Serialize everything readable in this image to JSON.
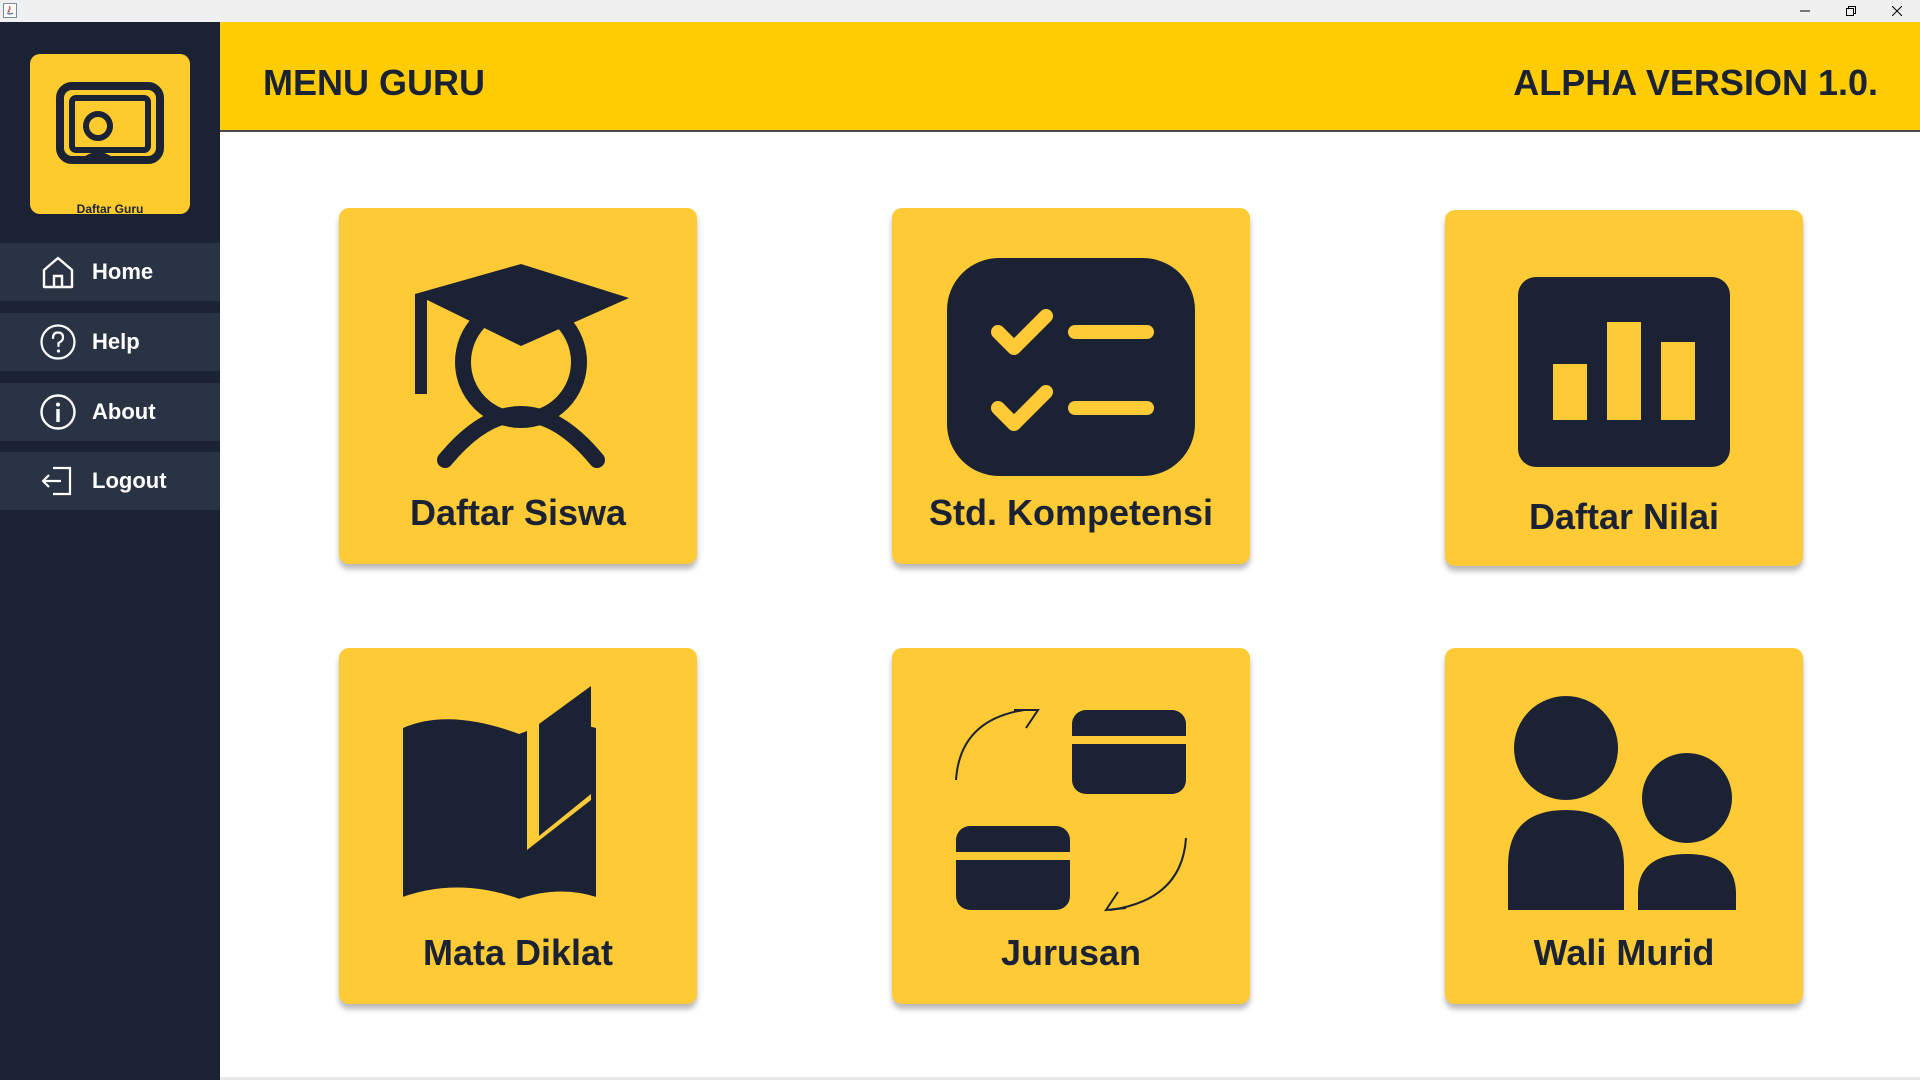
{
  "window": {
    "title_icon": "java-app-icon",
    "controls": [
      {
        "name": "minimize-icon",
        "glyph": "—"
      },
      {
        "name": "restore-icon",
        "glyph": "❐"
      },
      {
        "name": "close-icon",
        "glyph": "✕"
      }
    ]
  },
  "sidebar": {
    "logo_text": "Daftar Guru",
    "items": [
      {
        "label": "Home",
        "icon": "home-icon"
      },
      {
        "label": "Help",
        "icon": "help-icon"
      },
      {
        "label": "About",
        "icon": "info-icon"
      },
      {
        "label": "Logout",
        "icon": "logout-icon"
      }
    ]
  },
  "header": {
    "title": "MENU GURU",
    "version": "ALPHA VERSION 1.0."
  },
  "menu": {
    "cards": [
      {
        "label": "Daftar Siswa",
        "icon": "graduate-icon"
      },
      {
        "label": "Std. Kompetensi",
        "icon": "checklist-icon"
      },
      {
        "label": "Daftar Nilai",
        "icon": "bar-chart-icon"
      },
      {
        "label": "Mata Diklat",
        "icon": "book-icon"
      },
      {
        "label": "Jurusan",
        "icon": "swap-icon"
      },
      {
        "label": "Wali Murid",
        "icon": "users-icon"
      }
    ]
  },
  "colors": {
    "sidebar_bg": "#1a2233",
    "sidebar_item_bg": "#2a3343",
    "header_bg": "#fecc00",
    "card_bg": "#fecb36",
    "icon_dark": "#1a2233"
  }
}
